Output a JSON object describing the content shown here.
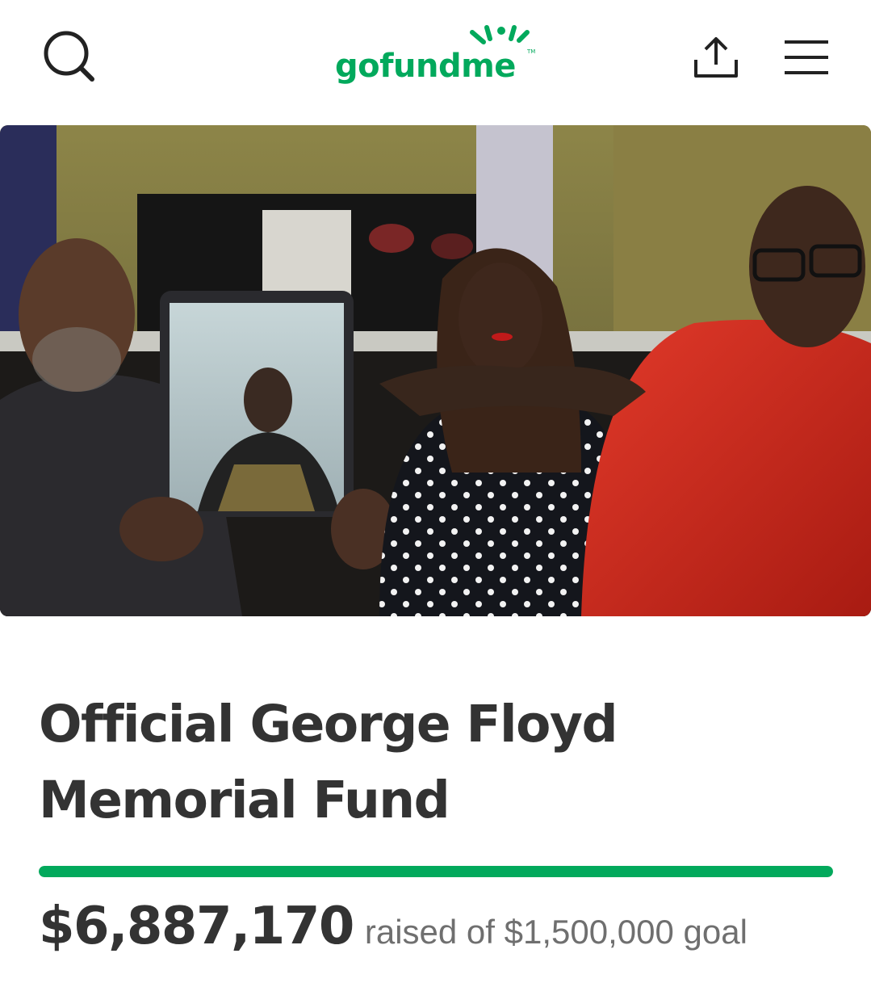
{
  "header": {
    "search_icon": "search-icon",
    "logo_text": "gofundme",
    "logo_tm": "TM",
    "share_icon": "share-icon",
    "menu_icon": "hamburger-menu-icon",
    "brand_color": "#02a95c"
  },
  "campaign": {
    "title": "Official George Floyd Memorial Fund",
    "amount_raised": "$6,887,170",
    "goal_text": "raised of $1,500,000 goal",
    "progress_fraction": 1.0,
    "progress_color": "#02a95c"
  }
}
